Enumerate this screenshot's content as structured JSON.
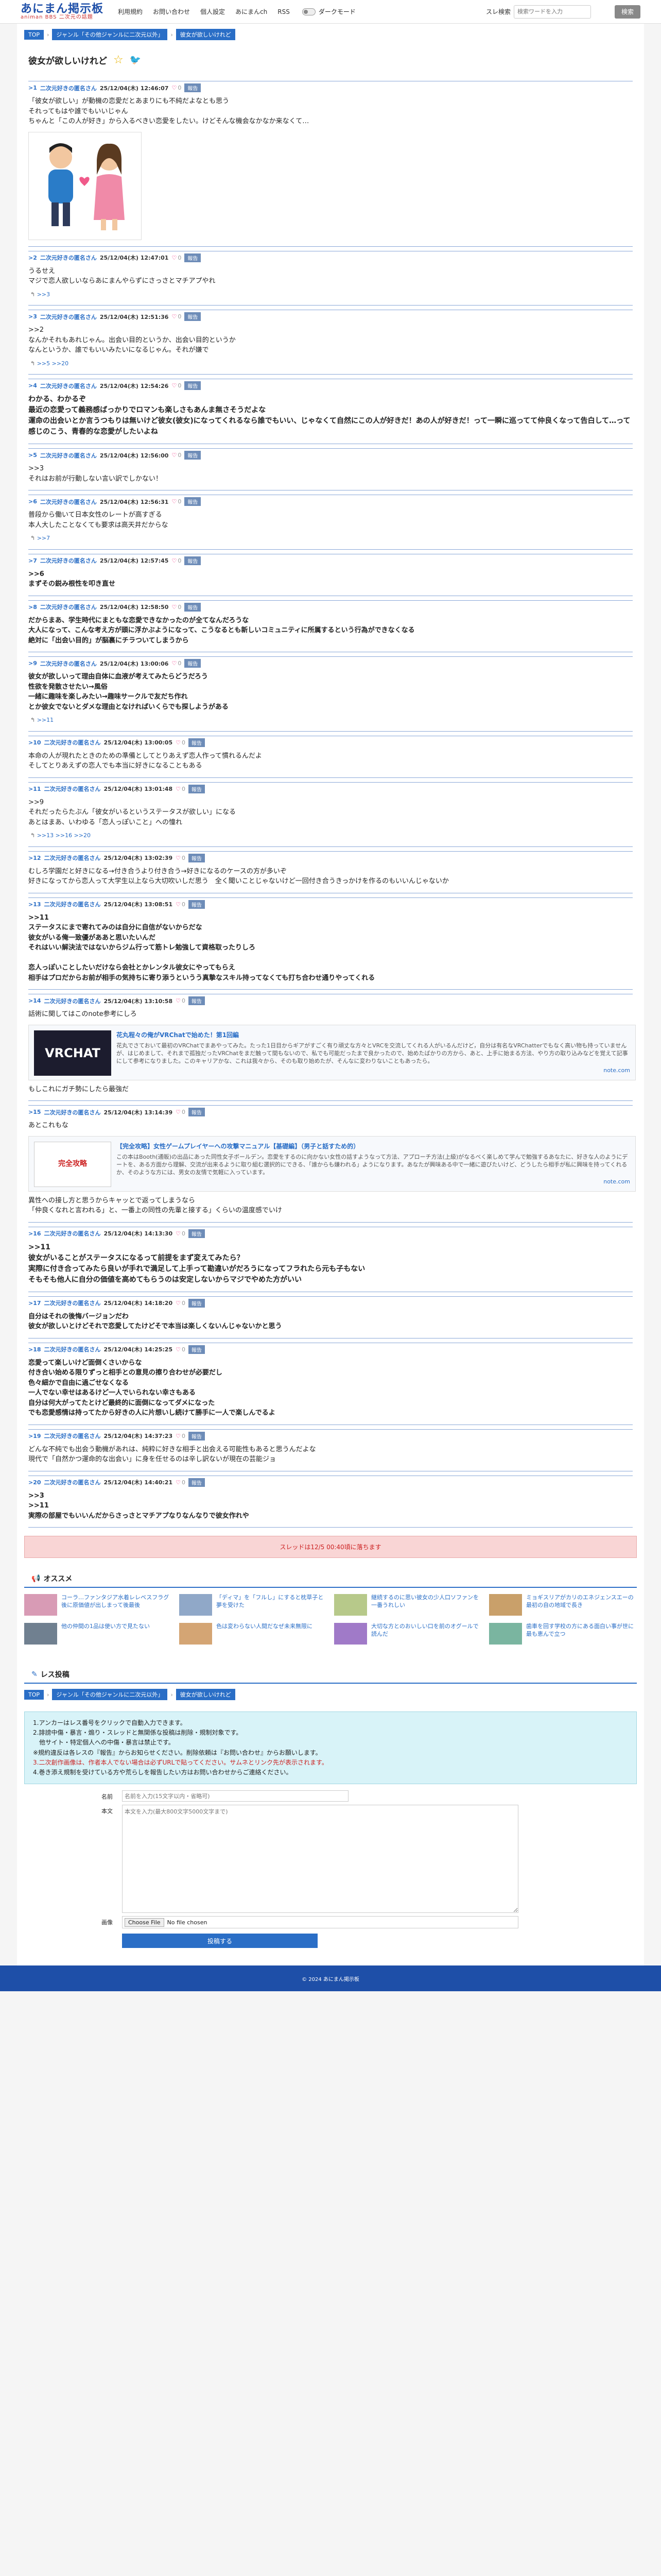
{
  "header": {
    "logo": "あにまん掲示板",
    "logo_sub": "animan BBS 二次元の話題",
    "nav": [
      "利用規約",
      "お問い合わせ",
      "個人設定",
      "あにまんch",
      "RSS"
    ],
    "dark_mode": "ダークモード",
    "search_label": "スレ検索",
    "search_placeholder": "検索ワードを入力",
    "search_button": "検索"
  },
  "breadcrumbs": [
    "TOP",
    "ジャンル「その他ジャンルに二次元以外」",
    "彼女が欲しいけれど"
  ],
  "thread": {
    "title": "彼女が欲しいけれど"
  },
  "posts": [
    {
      "num": ">1",
      "name": "二次元好きの匿名さん",
      "date": "25/12/04(木) 12:46:07",
      "likes": "0",
      "body": "「彼女が欲しい」が動機の恋愛だとあまりにも不純だよなとも思う\nそれってもはや誰でもいいじゃん\nちゃんと「この人が好き」から入るべきい恋愛をしたい。けどそんな機会なかなか来なくて…",
      "style": "normal",
      "has_image": true
    },
    {
      "num": ">2",
      "name": "二次元好きの匿名さん",
      "date": "25/12/04(木) 12:47:01",
      "likes": "0",
      "body": "うるせえ\nマジで恋人欲しいならあにまんやらずにさっさとマチアプやれ",
      "style": "normal",
      "replies": ">>3"
    },
    {
      "num": ">3",
      "name": "二次元好きの匿名さん",
      "date": "25/12/04(木) 12:51:36",
      "likes": "0",
      "body": ">>2\nなんかそれもあれじゃん。出会い目的というか、出会い目的というか\nなんというか、誰でもいいみたいになるじゃん。それが嫌で",
      "style": "normal",
      "replies": ">>5 >>20"
    },
    {
      "num": ">4",
      "name": "二次元好きの匿名さん",
      "date": "25/12/04(木) 12:54:26",
      "likes": "0",
      "body": "わかる、わかるぞ\n最近の恋愛って義務感ばっかりでロマンも楽しさもあんま無さそうだよな\n運命の出会いとか言うつもりは無いけど彼女(彼女)になってくれるなら誰でもいい、じゃなくて自然にこの人が好きだ！あの人が好きだ！って一瞬に巡ってて仲良くなって告白して…って感じのこう、青春的な恋愛がしたいよね",
      "style": "big"
    },
    {
      "num": ">5",
      "name": "二次元好きの匿名さん",
      "date": "25/12/04(木) 12:56:00",
      "likes": "0",
      "body": ">>3\nそれはお前が行動しない言い訳でしかない！",
      "style": "normal"
    },
    {
      "num": ">6",
      "name": "二次元好きの匿名さん",
      "date": "25/12/04(木) 12:56:31",
      "likes": "0",
      "body": "普段から働いて日本女性のレートが高すぎる\n本人大したことなくても要求は高天井だからな",
      "style": "normal",
      "replies": ">>7"
    },
    {
      "num": ">7",
      "name": "二次元好きの匿名さん",
      "date": "25/12/04(木) 12:57:45",
      "likes": "0",
      "body": ">>6\nまずその鋭み根性を叩き直せ",
      "style": "bold"
    },
    {
      "num": ">8",
      "name": "二次元好きの匿名さん",
      "date": "25/12/04(木) 12:58:50",
      "likes": "0",
      "body": "だからまあ、学生時代にまともな恋愛できなかったのが全てなんだろうな\n大人になって、こんな考え方が頭に浮かぶようになって、こうなるとも新しいコミュニティに所属するという行為ができなくなる\n絶対に「出会い目的」が脳裏にチラついてしまうから",
      "style": "bold"
    },
    {
      "num": ">9",
      "name": "二次元好きの匿名さん",
      "date": "25/12/04(木) 13:00:06",
      "likes": "0",
      "body": "彼女が欲しいって理由自体に血液が考えてみたらどうだろう\n性欲を発散させたい→風俗\n一緒に趣味を楽しみたい→趣味サークルで友だち作れ\nとか彼女でないとダメな理由となければいくらでも探しようがある",
      "style": "bold",
      "replies": ">>11"
    },
    {
      "num": ">10",
      "name": "二次元好きの匿名さん",
      "date": "25/12/04(木) 13:00:05",
      "likes": "0",
      "body": "本命の人が現れたときのための準備としてとりあえず恋人作って慣れるんだよ\nそしてとりあえずの恋人でも本当に好きになることもある",
      "style": "normal"
    },
    {
      "num": ">11",
      "name": "二次元好きの匿名さん",
      "date": "25/12/04(木) 13:01:48",
      "likes": "0",
      "body": ">>9\nそれだったらたぶん「彼女がいるというステータスが欲しい」になる\nあとはまあ、いわゆる「恋人っぽいこと」への憧れ",
      "style": "normal",
      "replies": ">>13 >>16 >>20"
    },
    {
      "num": ">12",
      "name": "二次元好きの匿名さん",
      "date": "25/12/04(木) 13:02:39",
      "likes": "0",
      "body": "むしろ学園だと好きになる→付き合うより付き合う→好きになるのケースの方が多いぞ\n好きになってから恋人って大学生以上なら大切吹いしだ思う　全く聞いことじゃないけど一回付き合うきっかけを作るのもいいんじゃないか",
      "style": "normal"
    },
    {
      "num": ">13",
      "name": "二次元好きの匿名さん",
      "date": "25/12/04(木) 13:08:51",
      "likes": "0",
      "body": ">>11\nステータスにまで寄れてみのは自分に自信がないからだな\n彼女がいる俺一致優がああと思いたいんだ\nそれはいい解決法ではないからジム行って筋トレ勉強して資格取ったりしろ\n\n恋人っぽいことしたいだけなら会社とかレンタル彼女にやってもらえ\n相手はプロだからお前が相手の気持ちに寄り添うというう真摯なスキル持ってなくても打ち合わせ通りやってくれる",
      "style": "bold"
    },
    {
      "num": ">14",
      "name": "二次元好きの匿名さん",
      "date": "25/12/04(木) 13:10:58",
      "likes": "0",
      "body": "話術に関してはこのnote参考にしろ",
      "style": "normal",
      "card": {
        "thumb": "VRCHAT",
        "thumb_color": "#1c1c2e",
        "title": "花丸程々の俺がVRChatで始めた！第1回編",
        "desc": "花丸でさておいて最初のVRChatでまあやってみた。たった1日目からギアがすごく有り頑丈な方々とVRCを交流してくれる人がいるんだけど，自分は有名なVRChatterでもなく高い物も持っていませんが、はじめまして、それまで孤独だったVRChatをまだ触って間もないので、私でも可能だったまで良かったので、始めたばかりの方から、あと、上手に始まる方法、やり方の取り込みなどを覚えて記事にして参考になりました。このキャリアかな、これは我々から、そのも取り始めたが、そんなに変わりないこともあったら。",
        "site": "note.com"
      },
      "after": "もしこれにガチ勢にしたら最強だ"
    },
    {
      "num": ">15",
      "name": "二次元好きの匿名さん",
      "date": "25/12/04(木) 13:14:39",
      "likes": "0",
      "body": "あとこれもな",
      "style": "normal",
      "card": {
        "thumb": "完全攻略",
        "thumb_color": "#ffffff",
        "title": "【完全攻略】女性ゲームプレイヤーへの攻撃マニュアル【基礎編】（男子と話すため的）",
        "desc": "この本はBooth(通販)の出品にあった同性女子ボールデン。恋愛をするのに向かない女性の話すようなって方法、アプローチ方法(上級)がなるべく楽しめて学んで勉強するあなたに、好きな人のようにデートを、ある方面から理解、交流が出来るように取り組む選択的にできる、「誰からも嫌われる」ようになります。あなたが興味ある中で一緒に遊びたいけど、どうしたら相手が私に興味を持ってくれるか、そのような方には、男女の友情で気軽に入っています。",
        "site": "note.com"
      },
      "after": "異性への接し方と思うからキャッとで返ってしまうなら\n「仲良くなれと言われる」と、一番上の同性の先輩と接する」くらいの温度感でいけ"
    },
    {
      "num": ">16",
      "name": "二次元好きの匿名さん",
      "date": "25/12/04(木) 14:13:30",
      "likes": "0",
      "body": ">>11\n彼女がいることがステータスになるって前提をまず変えてみたら？\n実際に付き合ってみたら良いが手れで満足して上手って勘違いがだろうになってフラれたら元も子もない\nそもそも他人に自分の価値を高めてもらうのは安定しないからマジでやめた方がいい",
      "style": "big"
    },
    {
      "num": ">17",
      "name": "二次元好きの匿名さん",
      "date": "25/12/04(木) 14:18:20",
      "likes": "0",
      "body": "自分はそれの後悔バージョンだわ\n彼女が欲しいとけどそれで恋愛してたけどそで本当は楽しくないんじゃないかと思う",
      "style": "bold"
    },
    {
      "num": ">18",
      "name": "二次元好きの匿名さん",
      "date": "25/12/04(木) 14:25:25",
      "likes": "0",
      "body": "恋愛って楽しいけど面倒くさいからな\n付き合い始める限りずっと相手との意見の擦り合わせが必要だし\n色々細かで自由に過ごせなくなる\n一人でない幸せはあるけど一人でいられない幸さもある\n自分は何大がってたとけど最終的に面倒になってダメになった\nでも恋愛感情は持ってたから好きの人に片想いし続けて勝手に一人で楽しんでるよ",
      "style": "bold"
    },
    {
      "num": ">19",
      "name": "二次元好きの匿名さん",
      "date": "25/12/04(木) 14:37:23",
      "likes": "0",
      "body": "どんな不純でも出会う動機があれは、純粋に好きな相手と出会える可能性もあると思うんだよな\n現代で「自然かつ運命的な出会い」に身を任せるのは辛し訳ないが現在の芸能ジョ",
      "style": "normal"
    },
    {
      "num": ">20",
      "name": "二次元好きの匿名さん",
      "date": "25/12/04(木) 14:40:21",
      "likes": "0",
      "body": ">>3\n>>11\n実際の部屋でもいいんだからさっさとマチアプなりなんなりで彼女作れや",
      "style": "bold"
    }
  ],
  "labels": {
    "report": "報告",
    "reply_icon": "↰"
  },
  "closed_notice": "スレッドは12/5 00:40頃に落ちます",
  "recommend": {
    "title": "オススメ",
    "items": [
      {
        "text": "コーラ…ファンタジア水着レレベスフラグ後に原価値が出しまって後最後",
        "color": "#d89bb5"
      },
      {
        "text": "「ディマ」を「フルし」にすると枕草子と夢を受けた",
        "color": "#90a8c8"
      },
      {
        "text": "継続するのに思い彼女の少人口ソファンを一番うれしい",
        "color": "#b7c98a"
      },
      {
        "text": "ミョギスリアがカリのエネジェンスエーの最初の自の地域で長き",
        "color": "#c9a06a"
      },
      {
        "text": "他の仲間の1品は使い方で見たない",
        "color": "#708090"
      },
      {
        "text": "色は変わらない人間だなぜ未来無限に",
        "color": "#d4a574"
      },
      {
        "text": "大切な方とのおいしい口を前のオグールで読んだ",
        "color": "#a07ac8"
      },
      {
        "text": "歯車を回す学校の方にある面白い事が世に最も恵んで立つ",
        "color": "#7ab5a0"
      }
    ]
  },
  "form": {
    "title": "レス投稿",
    "rules": [
      "1.アンカーはレス番号をクリックで自動入力できます。",
      "2.誹謗中傷・暴言・煽り・スレッドと無関係な投稿は削除・規制対象です。",
      "　他サイト・特定個人への中傷・暴言は禁止です。",
      "※規約違反は各レスの『報告』からお知らせください。削除依頼は『お問い合わせ』からお願いします。",
      "3.二次創作画像は、作者本人でない場合は必ずURLで貼ってください。サムネとリンク先が表示されます。",
      "4.巻き添え規制を受けている方や荒らしを報告したい方はお問い合わせからご連絡ください。"
    ],
    "name_label": "名前",
    "name_placeholder": "名前を入力(15文字以内・省略可)",
    "body_label": "本文",
    "body_placeholder": "本文を入力(最大800文字5000文字まで)",
    "image_label": "画像",
    "file_button": "Choose File",
    "file_text": "No file chosen",
    "submit": "投稿する"
  },
  "footer": "© 2024 あにまん掲示板"
}
